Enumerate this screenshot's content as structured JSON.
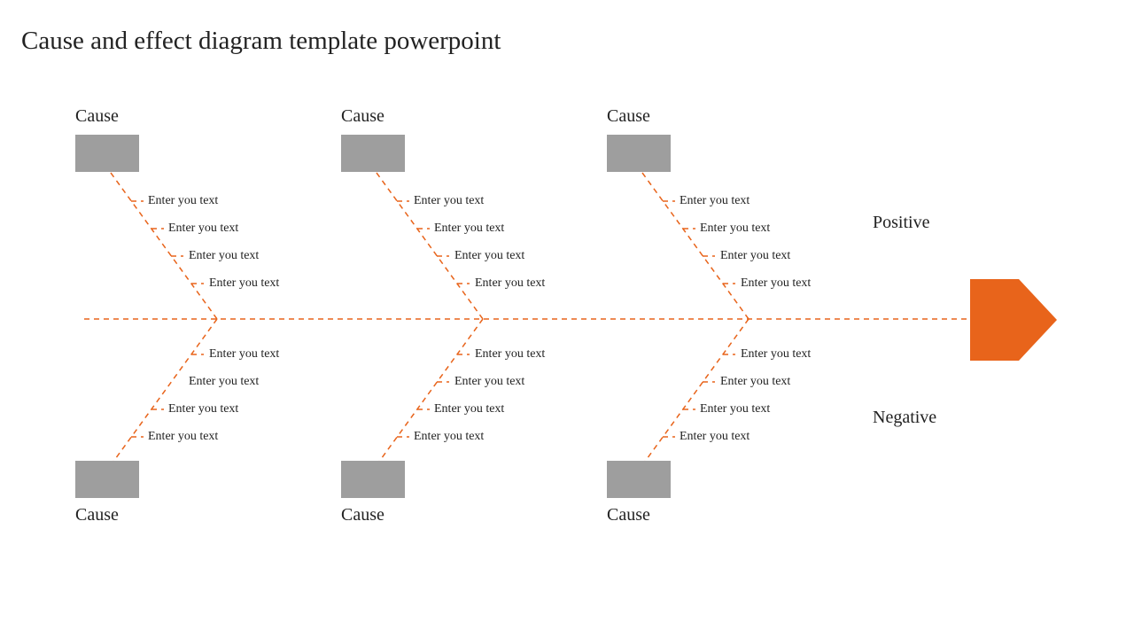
{
  "title": "Cause and effect diagram template powerpoint",
  "sideLabels": {
    "positive": "Positive",
    "negative": "Negative"
  },
  "causes": {
    "top": [
      {
        "label": "Cause",
        "items": [
          "Enter you text",
          "Enter you text",
          "Enter you text",
          "Enter you text"
        ]
      },
      {
        "label": "Cause",
        "items": [
          "Enter you text",
          "Enter you text",
          "Enter you text",
          "Enter you text"
        ]
      },
      {
        "label": "Cause",
        "items": [
          "Enter you text",
          "Enter you text",
          "Enter you text",
          "Enter you text"
        ]
      }
    ],
    "bottom": [
      {
        "label": "Cause",
        "items": [
          "Enter you text",
          "Enter you text",
          "Enter you text",
          "Enter you text"
        ]
      },
      {
        "label": "Cause",
        "items": [
          "Enter you text",
          "Enter you text",
          "Enter you text",
          "Enter you text"
        ]
      },
      {
        "label": "Cause",
        "items": [
          "Enter you text",
          "Enter you text",
          "Enter you text",
          "Enter you text"
        ]
      }
    ]
  },
  "colors": {
    "accent": "#e8641b",
    "gray": "#9e9e9e"
  }
}
